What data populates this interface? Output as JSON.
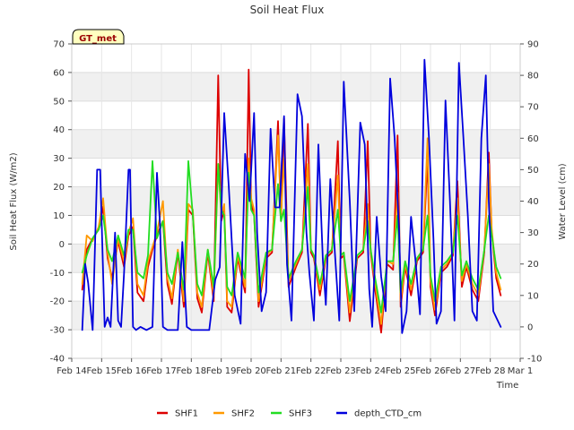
{
  "chart_data": {
    "type": "line",
    "title": "Soil Heat Flux",
    "xlabel": "Time",
    "ylabel": "Soil Heat Flux (W/m2)",
    "y2label": "Water Level (cm)",
    "badge": "GT_met",
    "xlim": [
      14,
      29
    ],
    "ylim": [
      -40,
      70
    ],
    "y2lim": [
      -10,
      90
    ],
    "grid": true,
    "legend_position": "bottom",
    "x_tick_labels": [
      "Feb 14",
      "Feb 15",
      "Feb 16",
      "Feb 17",
      "Feb 18",
      "Feb 19",
      "Feb 20",
      "Feb 21",
      "Feb 22",
      "Feb 23",
      "Feb 24",
      "Feb 25",
      "Feb 26",
      "Feb 27",
      "Feb 28",
      "Mar 1"
    ],
    "x_tick_values": [
      14,
      15,
      16,
      17,
      18,
      19,
      20,
      21,
      22,
      23,
      24,
      25,
      26,
      27,
      28,
      29
    ],
    "y_ticks": [
      -40,
      -30,
      -20,
      -10,
      0,
      10,
      20,
      30,
      40,
      50,
      60,
      70
    ],
    "y2_ticks": [
      -10,
      0,
      10,
      20,
      30,
      40,
      50,
      60,
      70,
      80,
      90
    ],
    "series": [
      {
        "name": "SHF1",
        "color": "#dd0000",
        "axis": "left",
        "x": [
          14.35,
          14.5,
          14.7,
          14.9,
          15.05,
          15.2,
          15.35,
          15.55,
          15.75,
          15.9,
          16.05,
          16.2,
          16.4,
          16.55,
          16.7,
          16.85,
          17.05,
          17.2,
          17.35,
          17.55,
          17.75,
          17.9,
          18.05,
          18.2,
          18.35,
          18.55,
          18.75,
          18.9,
          19.0,
          19.1,
          19.2,
          19.35,
          19.55,
          19.8,
          19.92,
          20.0,
          20.1,
          20.25,
          20.5,
          20.7,
          20.9,
          21.0,
          21.1,
          21.25,
          21.5,
          21.7,
          21.9,
          22.0,
          22.1,
          22.3,
          22.5,
          22.7,
          22.9,
          23.0,
          23.1,
          23.3,
          23.55,
          23.75,
          23.9,
          24.0,
          24.15,
          24.35,
          24.55,
          24.75,
          24.9,
          25.0,
          25.15,
          25.35,
          25.55,
          25.75,
          25.9,
          26.0,
          26.15,
          26.35,
          26.55,
          26.75,
          26.9,
          27.05,
          27.2,
          27.4,
          27.6,
          27.8,
          27.95,
          28.05,
          28.2,
          28.35
        ],
        "y": [
          -16,
          -2,
          2,
          5,
          13,
          -5,
          -12,
          1,
          -8,
          3,
          6,
          -17,
          -20,
          -8,
          -2,
          3,
          8,
          -14,
          -21,
          -3,
          -22,
          12,
          10,
          -19,
          -24,
          -3,
          -20,
          59,
          8,
          12,
          -22,
          -24,
          -5,
          -17,
          61,
          14,
          10,
          -22,
          -5,
          -3,
          43,
          8,
          44,
          -15,
          -8,
          -3,
          42,
          -3,
          -5,
          -18,
          -5,
          -3,
          36,
          -5,
          -4,
          -27,
          -5,
          -3,
          36,
          -3,
          -16,
          -31,
          -7,
          -9,
          38,
          -22,
          -8,
          -18,
          -6,
          -3,
          30,
          -15,
          -25,
          -10,
          -8,
          -4,
          22,
          -15,
          -8,
          -16,
          -20,
          -3,
          32,
          4,
          -12,
          -18
        ]
      },
      {
        "name": "SHF2",
        "color": "#ff9900",
        "axis": "left",
        "x": [
          14.35,
          14.5,
          14.7,
          14.9,
          15.05,
          15.2,
          15.35,
          15.55,
          15.75,
          15.9,
          16.05,
          16.2,
          16.4,
          16.55,
          16.7,
          16.85,
          17.05,
          17.2,
          17.35,
          17.55,
          17.75,
          17.9,
          18.05,
          18.2,
          18.35,
          18.55,
          18.75,
          18.9,
          19.0,
          19.1,
          19.2,
          19.35,
          19.55,
          19.8,
          19.92,
          20.0,
          20.1,
          20.25,
          20.5,
          20.7,
          20.9,
          21.0,
          21.1,
          21.25,
          21.5,
          21.7,
          21.9,
          22.0,
          22.1,
          22.3,
          22.5,
          22.7,
          22.9,
          23.0,
          23.1,
          23.3,
          23.55,
          23.75,
          23.9,
          24.0,
          24.15,
          24.35,
          24.55,
          24.75,
          24.9,
          25.0,
          25.15,
          25.35,
          25.55,
          25.75,
          25.9,
          26.0,
          26.15,
          26.35,
          26.55,
          26.75,
          26.9,
          27.05,
          27.2,
          27.4,
          27.6,
          27.8,
          27.95,
          28.05,
          28.2,
          28.35
        ],
        "y": [
          -14,
          3,
          1,
          6,
          16,
          -3,
          -14,
          2,
          -6,
          4,
          9,
          -14,
          -18,
          -6,
          -1,
          4,
          15,
          -12,
          -19,
          -2,
          -20,
          14,
          12,
          -17,
          -22,
          -2,
          -18,
          28,
          10,
          14,
          -20,
          -22,
          -4,
          -15,
          30,
          16,
          12,
          -20,
          -4,
          -2,
          38,
          10,
          30,
          -13,
          -7,
          -2,
          28,
          -2,
          -4,
          -16,
          -4,
          -2,
          24,
          -4,
          -3,
          -24,
          -4,
          -2,
          14,
          -2,
          -14,
          -28,
          -6,
          -7,
          18,
          -20,
          -7,
          -16,
          -5,
          -2,
          37,
          -13,
          -23,
          -9,
          -7,
          -3,
          16,
          -13,
          -7,
          -14,
          -18,
          -2,
          28,
          5,
          -10,
          -16
        ]
      },
      {
        "name": "SHF3",
        "color": "#22dd22",
        "axis": "left",
        "x": [
          14.35,
          14.5,
          14.7,
          14.9,
          15.05,
          15.2,
          15.35,
          15.55,
          15.75,
          15.9,
          16.05,
          16.2,
          16.4,
          16.55,
          16.7,
          16.85,
          17.05,
          17.2,
          17.35,
          17.55,
          17.75,
          17.9,
          18.05,
          18.2,
          18.35,
          18.55,
          18.75,
          18.9,
          19.0,
          19.1,
          19.2,
          19.35,
          19.55,
          19.8,
          19.92,
          20.0,
          20.1,
          20.25,
          20.5,
          20.7,
          20.9,
          21.0,
          21.1,
          21.25,
          21.5,
          21.7,
          21.9,
          22.0,
          22.1,
          22.3,
          22.5,
          22.7,
          22.9,
          23.0,
          23.1,
          23.3,
          23.55,
          23.75,
          23.9,
          24.0,
          24.15,
          24.35,
          24.55,
          24.75,
          24.9,
          25.0,
          25.15,
          25.35,
          25.55,
          25.75,
          25.9,
          26.0,
          26.15,
          26.35,
          26.55,
          26.75,
          26.9,
          27.05,
          27.2,
          27.4,
          27.6,
          27.8,
          27.95,
          28.05,
          28.2,
          28.35
        ],
        "y": [
          -10,
          -4,
          2,
          5,
          10,
          -2,
          -6,
          3,
          -4,
          5,
          5,
          -10,
          -12,
          -4,
          29,
          2,
          8,
          -10,
          -14,
          -3,
          -16,
          29,
          10,
          -14,
          -18,
          -2,
          -15,
          28,
          12,
          10,
          -15,
          -18,
          -3,
          -12,
          25,
          12,
          10,
          -17,
          -3,
          -2,
          21,
          8,
          12,
          -12,
          -6,
          -2,
          20,
          -2,
          -4,
          -14,
          -4,
          -2,
          12,
          -4,
          -3,
          -20,
          -4,
          -2,
          8,
          -2,
          -12,
          -24,
          -6,
          -6,
          10,
          -17,
          -6,
          -14,
          -5,
          -2,
          10,
          -11,
          -20,
          -8,
          -6,
          -3,
          10,
          -11,
          -6,
          -12,
          -16,
          -2,
          10,
          3,
          -8,
          -12
        ]
      },
      {
        "name": "depth_CTD_cm",
        "color": "#0000dd",
        "axis": "right",
        "x": [
          14.35,
          14.45,
          14.55,
          14.7,
          14.85,
          14.95,
          15.1,
          15.2,
          15.3,
          15.45,
          15.55,
          15.65,
          15.75,
          15.9,
          15.95,
          16.05,
          16.15,
          16.3,
          16.5,
          16.7,
          16.85,
          16.95,
          17.05,
          17.2,
          17.35,
          17.55,
          17.7,
          17.85,
          18.0,
          18.1,
          18.3,
          18.45,
          18.6,
          18.8,
          18.95,
          19.1,
          19.25,
          19.45,
          19.65,
          19.8,
          19.95,
          20.1,
          20.2,
          20.35,
          20.5,
          20.65,
          20.8,
          20.95,
          21.1,
          21.2,
          21.35,
          21.55,
          21.7,
          21.85,
          21.95,
          22.1,
          22.25,
          22.4,
          22.5,
          22.65,
          22.8,
          22.95,
          23.1,
          23.3,
          23.45,
          23.65,
          23.8,
          23.95,
          24.05,
          24.2,
          24.35,
          24.5,
          24.65,
          24.8,
          24.95,
          25.05,
          25.2,
          25.35,
          25.5,
          25.65,
          25.8,
          25.95,
          26.1,
          26.2,
          26.35,
          26.5,
          26.65,
          26.8,
          26.95,
          27.1,
          27.25,
          27.4,
          27.55,
          27.7,
          27.85,
          27.95,
          28.1,
          28.2,
          28.35
        ],
        "y": [
          -1,
          20,
          14,
          -1,
          50,
          50,
          0,
          3,
          0,
          30,
          2,
          0,
          17,
          50,
          50,
          0,
          -1,
          0,
          -1,
          0,
          49,
          33,
          0,
          -1,
          -1,
          -1,
          27,
          0,
          -1,
          -1,
          -1,
          -1,
          -1,
          15,
          19,
          68,
          45,
          10,
          1,
          55,
          40,
          68,
          30,
          5,
          11,
          63,
          38,
          38,
          67,
          20,
          2,
          74,
          67,
          30,
          17,
          2,
          58,
          21,
          7,
          47,
          24,
          2,
          78,
          40,
          5,
          65,
          58,
          12,
          0,
          35,
          16,
          5,
          79,
          60,
          30,
          -2,
          5,
          35,
          21,
          4,
          85,
          60,
          28,
          1,
          5,
          72,
          40,
          2,
          84,
          60,
          35,
          5,
          2,
          60,
          80,
          40,
          5,
          3,
          0
        ]
      }
    ]
  }
}
